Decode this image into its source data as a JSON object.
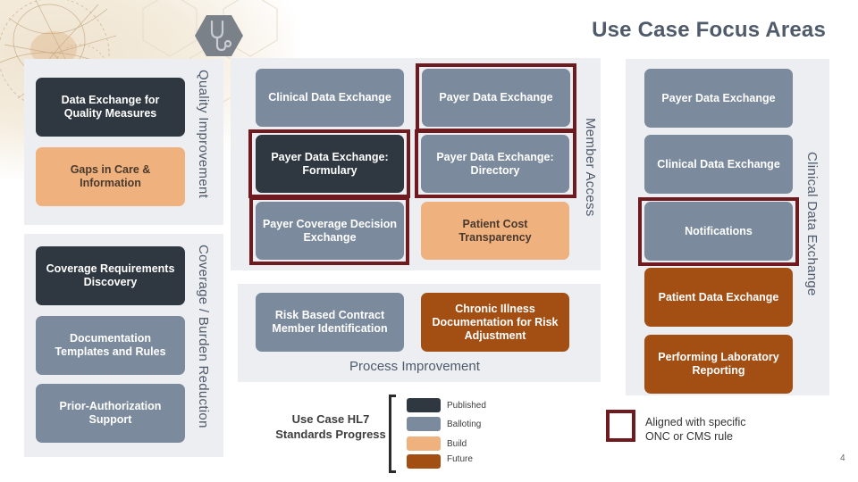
{
  "title": "Use Case Focus Areas",
  "header_icon": "stethoscope-icon",
  "colors": {
    "published": "#2f3740",
    "balloting": "#7b8a9c",
    "build": "#efb17e",
    "future": "#a34f14",
    "rule_highlight": "#6e1a1e",
    "panel_bg": "#eceef2",
    "label_text": "#4f5b6b"
  },
  "quality_improvement": {
    "label": "Quality Improvement",
    "items": [
      {
        "label": "Data Exchange for Quality Measures",
        "status": "published"
      },
      {
        "label": "Gaps in Care & Information",
        "status": "build"
      }
    ]
  },
  "coverage_burden": {
    "label": "Coverage / Burden Reduction",
    "items": [
      {
        "label": "Coverage Requirements Discovery",
        "status": "published"
      },
      {
        "label": "Documentation Templates and Rules",
        "status": "balloting"
      },
      {
        "label": "Prior-Authorization Support",
        "status": "balloting"
      }
    ]
  },
  "member_access": {
    "label": "Member Access",
    "items": [
      {
        "label": "Clinical Data Exchange",
        "status": "balloting",
        "rule_aligned": false
      },
      {
        "label": "Payer Data Exchange",
        "status": "balloting",
        "rule_aligned": true
      },
      {
        "label": "Payer Data Exchange: Formulary",
        "status": "published",
        "rule_aligned": true
      },
      {
        "label": "Payer Data Exchange: Directory",
        "status": "balloting",
        "rule_aligned": true
      },
      {
        "label": "Payer Coverage Decision Exchange",
        "status": "balloting",
        "rule_aligned": true
      },
      {
        "label": "Patient Cost Transparency",
        "status": "build",
        "rule_aligned": false
      }
    ]
  },
  "process_improvement": {
    "label": "Process Improvement",
    "items": [
      {
        "label": "Risk Based Contract Member Identification",
        "status": "balloting"
      },
      {
        "label": "Chronic Illness Documentation  for Risk Adjustment",
        "status": "future"
      }
    ]
  },
  "clinical_data_exchange": {
    "label": "Clinical Data Exchange",
    "items": [
      {
        "label": "Payer Data Exchange",
        "status": "balloting",
        "rule_aligned": false
      },
      {
        "label": "Clinical Data Exchange",
        "status": "balloting",
        "rule_aligned": false
      },
      {
        "label": "Notifications",
        "status": "balloting",
        "rule_aligned": true
      },
      {
        "label": "Patient Data Exchange",
        "status": "future",
        "rule_aligned": false
      },
      {
        "label": "Performing Laboratory Reporting",
        "status": "future",
        "rule_aligned": false
      }
    ]
  },
  "legend": {
    "title": "Use Case HL7 Standards Progress",
    "entries": [
      {
        "label": "Published",
        "status": "published"
      },
      {
        "label": "Balloting",
        "status": "balloting"
      },
      {
        "label": "Build",
        "status": "build"
      },
      {
        "label": "Future",
        "status": "future"
      }
    ],
    "rule_note": "Aligned with specific ONC or CMS rule"
  },
  "page_number": "4"
}
